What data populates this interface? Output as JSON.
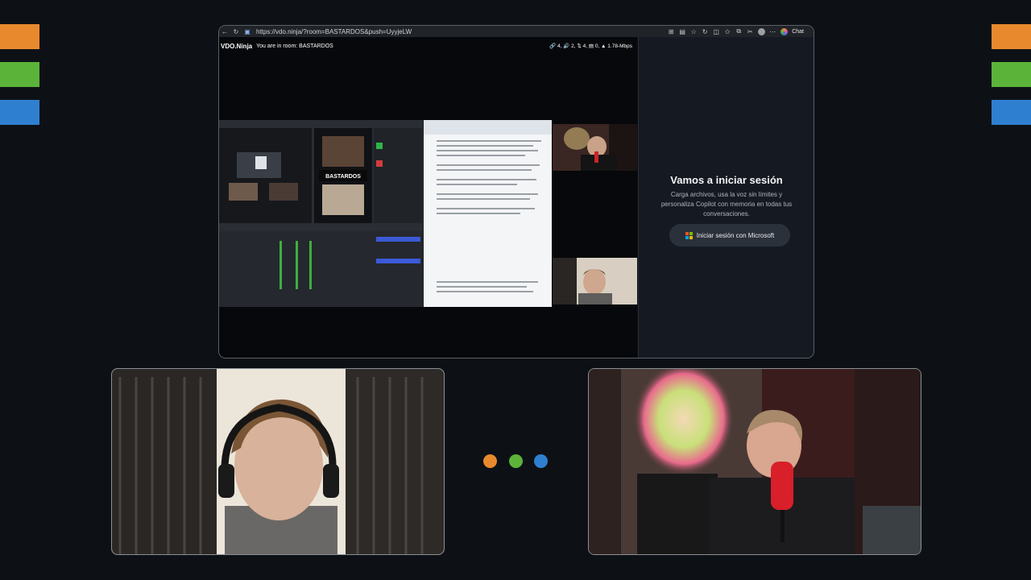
{
  "brand_colors": {
    "orange": "#e8892d",
    "green": "#5cb33a",
    "blue": "#2f7fd1"
  },
  "browser": {
    "url": "https://vdo.ninja/?room=BASTARDOS&push=UyyjeLW",
    "chat_label": "Chat",
    "icons": [
      "back-icon",
      "refresh-icon",
      "camera-icon",
      "grid-icon",
      "reader-icon",
      "star-icon",
      "extensions-icon",
      "split-icon",
      "favorites-icon",
      "collections-icon",
      "screenshot-icon",
      "profile-icon",
      "more-icon",
      "copilot-icon"
    ]
  },
  "vdo": {
    "logo": "VDO.Ninja",
    "room_text": "You are in room: BASTARDOS",
    "stats": "🔗 4,  🔊 2,  ⇅ 4,  ▤ 0,  ▲ 1.78-Mbps"
  },
  "copilot": {
    "title": "Vamos a iniciar sesión",
    "description": "Carga archivos, usa la voz sin límites y personaliza Copilot con memoria en todas tus conversaciones.",
    "signin_label": "Iniciar sesión con Microsoft"
  },
  "shared_screen": {
    "overlay_title": "BASTARDOS"
  }
}
